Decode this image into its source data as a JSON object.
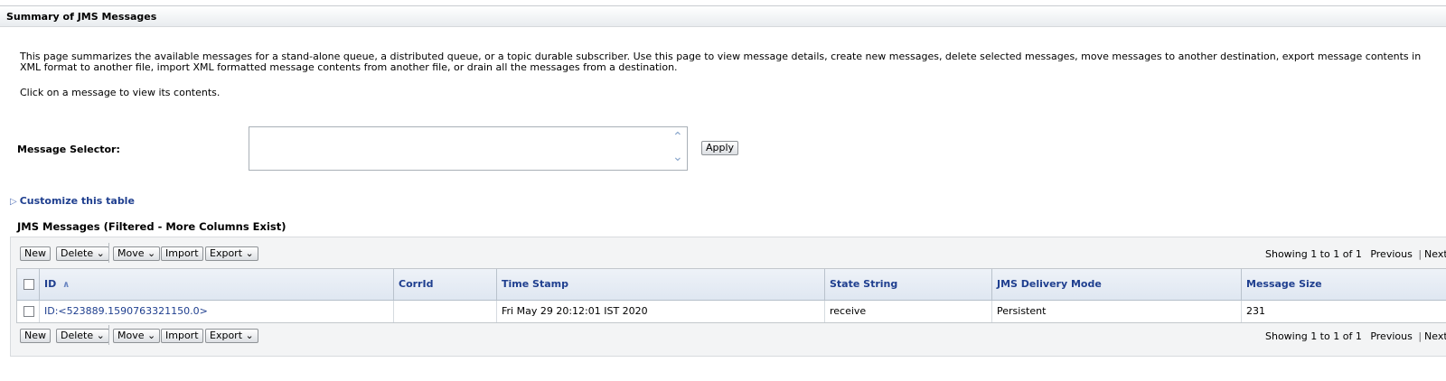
{
  "header": {
    "title": "Summary of JMS Messages"
  },
  "description": "This page summarizes the available messages for a stand-alone queue, a distributed queue, or a topic durable subscriber. Use this page to view message details, create new messages, delete selected messages, move messages to another destination, export message contents in XML format to another file, import XML formatted message contents from another file, or drain all the messages from a destination.",
  "click_text": "Click on a message to view its contents.",
  "selector": {
    "label": "Message Selector:",
    "value": "",
    "apply_label": "Apply"
  },
  "customize_label": "Customize this table",
  "table_caption": "JMS Messages (Filtered - More Columns Exist)",
  "toolbar": {
    "new_label": "New",
    "delete_label": "Delete",
    "move_label": "Move",
    "import_label": "Import",
    "export_label": "Export",
    "dropdown_glyph": "⌄",
    "showing": "Showing 1 to 1 of 1",
    "previous": "Previous",
    "next": "Next"
  },
  "table": {
    "columns": [
      "ID",
      "CorrId",
      "Time Stamp",
      "State String",
      "JMS Delivery Mode",
      "Message Size"
    ],
    "rows": [
      {
        "id": "ID:<523889.1590763321150.0>",
        "corr_id": "",
        "timestamp": "Fri May 29 20:12:01 IST 2020",
        "state": "receive",
        "delivery_mode": "Persistent",
        "size": "231"
      }
    ]
  },
  "icons": {
    "sort": "sort-ascending-icon",
    "scroll_up": "chevron-up-icon",
    "scroll_down": "chevron-down-icon",
    "expand": "triangle-right-icon"
  }
}
